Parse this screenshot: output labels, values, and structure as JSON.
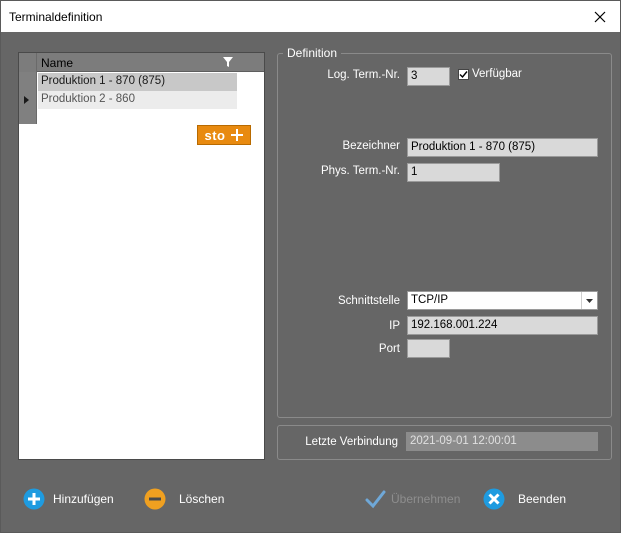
{
  "window": {
    "title": "Terminaldefinition"
  },
  "grid": {
    "column_name": "Name",
    "rows": [
      {
        "name": "Produktion 1 -  870 (875)"
      },
      {
        "name": "Produktion 2 - 860"
      }
    ]
  },
  "logo": {
    "text": "sto"
  },
  "definition": {
    "legend": "Definition",
    "log_term_label": "Log. Term.-Nr.",
    "log_term_value": "3",
    "available_label": "Verfügbar",
    "available_checked": true,
    "name_label": "Bezeichner",
    "name_value": "Produktion 1 -  870 (875)",
    "phys_term_label": "Phys. Term.-Nr.",
    "phys_term_value": "1",
    "interface_label": "Schnittstelle",
    "interface_value": "TCP/IP",
    "ip_label": "IP",
    "ip_value": "192.168.001.224",
    "port_label": "Port",
    "port_value": ""
  },
  "last_connection": {
    "label": "Letzte Verbindung",
    "value": "2021-09-01 12:00:01"
  },
  "buttons": {
    "add": "Hinzufügen",
    "delete": "Löschen",
    "apply": "Übernehmen",
    "exit": "Beenden"
  },
  "colors": {
    "accent_blue": "#1e9be0",
    "accent_orange": "#f0a020",
    "logo_orange": "#e88a10",
    "disabled": "#8e8e8e",
    "background": "#666666"
  }
}
